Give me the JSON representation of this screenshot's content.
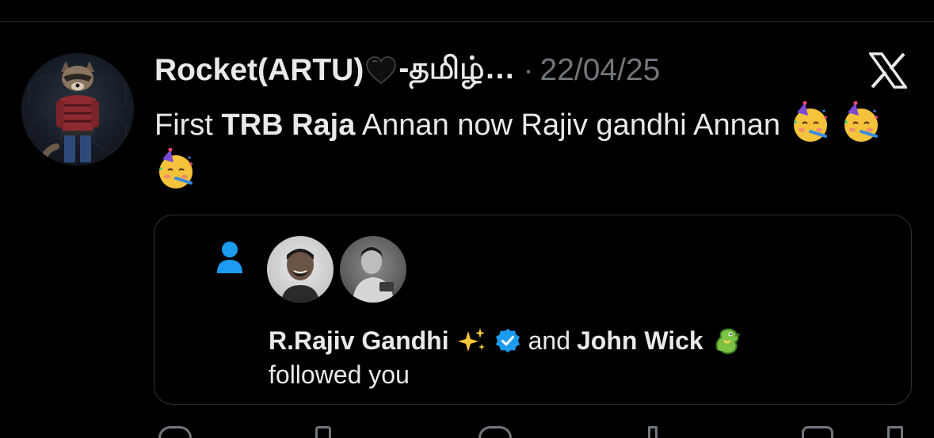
{
  "tweet": {
    "display_name": "Rocket(ARTU)",
    "name_suffix": "-தமிழ்…",
    "separator": "·",
    "date": "22/04/25",
    "text_prefix": "First ",
    "text_bold": "TRB Raja",
    "text_rest": " Annan now Rajiv gandhi Annan",
    "emojis": [
      "partying-face-emoji",
      "partying-face-emoji",
      "partying-face-emoji"
    ]
  },
  "quote": {
    "user_one": "R.Rajiv Gandhi",
    "connector": "and",
    "user_two": "John Wick",
    "action": "followed you"
  },
  "icons": {
    "heart": "black-heart-icon",
    "brand": "x-logo-icon",
    "person": "person-icon",
    "verified": "verified-badge-icon",
    "sparkles": "sparkles-icon",
    "dragon": "dragon-icon"
  },
  "colors": {
    "background": "#000000",
    "text": "#e7e9ea",
    "muted": "#71767b",
    "border": "#2f3336",
    "accent": "#1d9bf0"
  }
}
